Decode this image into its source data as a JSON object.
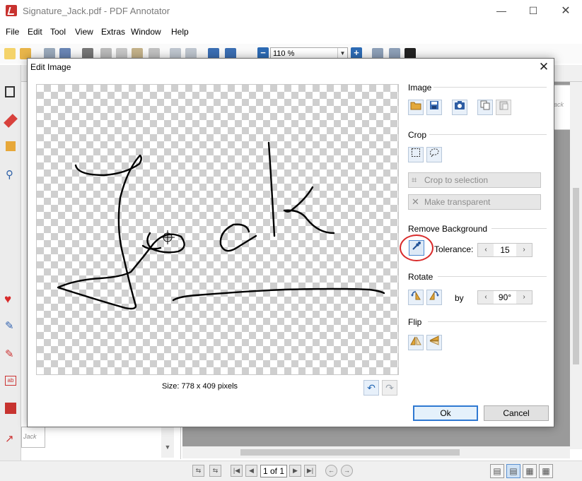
{
  "window": {
    "title": "Signature_Jack.pdf - PDF Annotator",
    "minimize": "—",
    "maximize": "☐",
    "close": "✕"
  },
  "menu": [
    "File",
    "Edit",
    "Tool",
    "View",
    "Extras",
    "Window",
    "Help"
  ],
  "toolbar": {
    "zoom": "110 %"
  },
  "thumbnail": {
    "text": "Jack"
  },
  "right_page": {
    "text": "ack"
  },
  "status": {
    "page": "1 of 1"
  },
  "dialog": {
    "title": "Edit Image",
    "close": "✕",
    "size_label": "Size: 778 x 409 pixels",
    "sections": {
      "image": "Image",
      "crop": "Crop",
      "remove_background": "Remove Background",
      "rotate": "Rotate",
      "flip": "Flip"
    },
    "crop_to_selection": "Crop to selection",
    "make_transparent": "Make transparent",
    "tolerance_label": "Tolerance:",
    "tolerance_value": "15",
    "rotate_by_label": "by",
    "rotate_value": "90°",
    "ok": "Ok",
    "cancel": "Cancel"
  },
  "colors": {
    "accent": "#2f79d2",
    "highlight_ring": "#d92b2b",
    "app_red": "#c8322f"
  },
  "icons": {
    "open": "folder-icon",
    "save": "save-icon",
    "camera": "camera-icon",
    "copy": "copy-icon",
    "paste": "paste-icon",
    "rect_select": "rectangle-select-icon",
    "lasso": "lasso-select-icon",
    "eyedropper": "eyedropper-icon",
    "rotate_left": "rotate-left-icon",
    "rotate_right": "rotate-right-icon",
    "flip_h": "flip-horizontal-icon",
    "flip_v": "flip-vertical-icon",
    "undo": "undo-icon",
    "redo": "redo-icon"
  }
}
